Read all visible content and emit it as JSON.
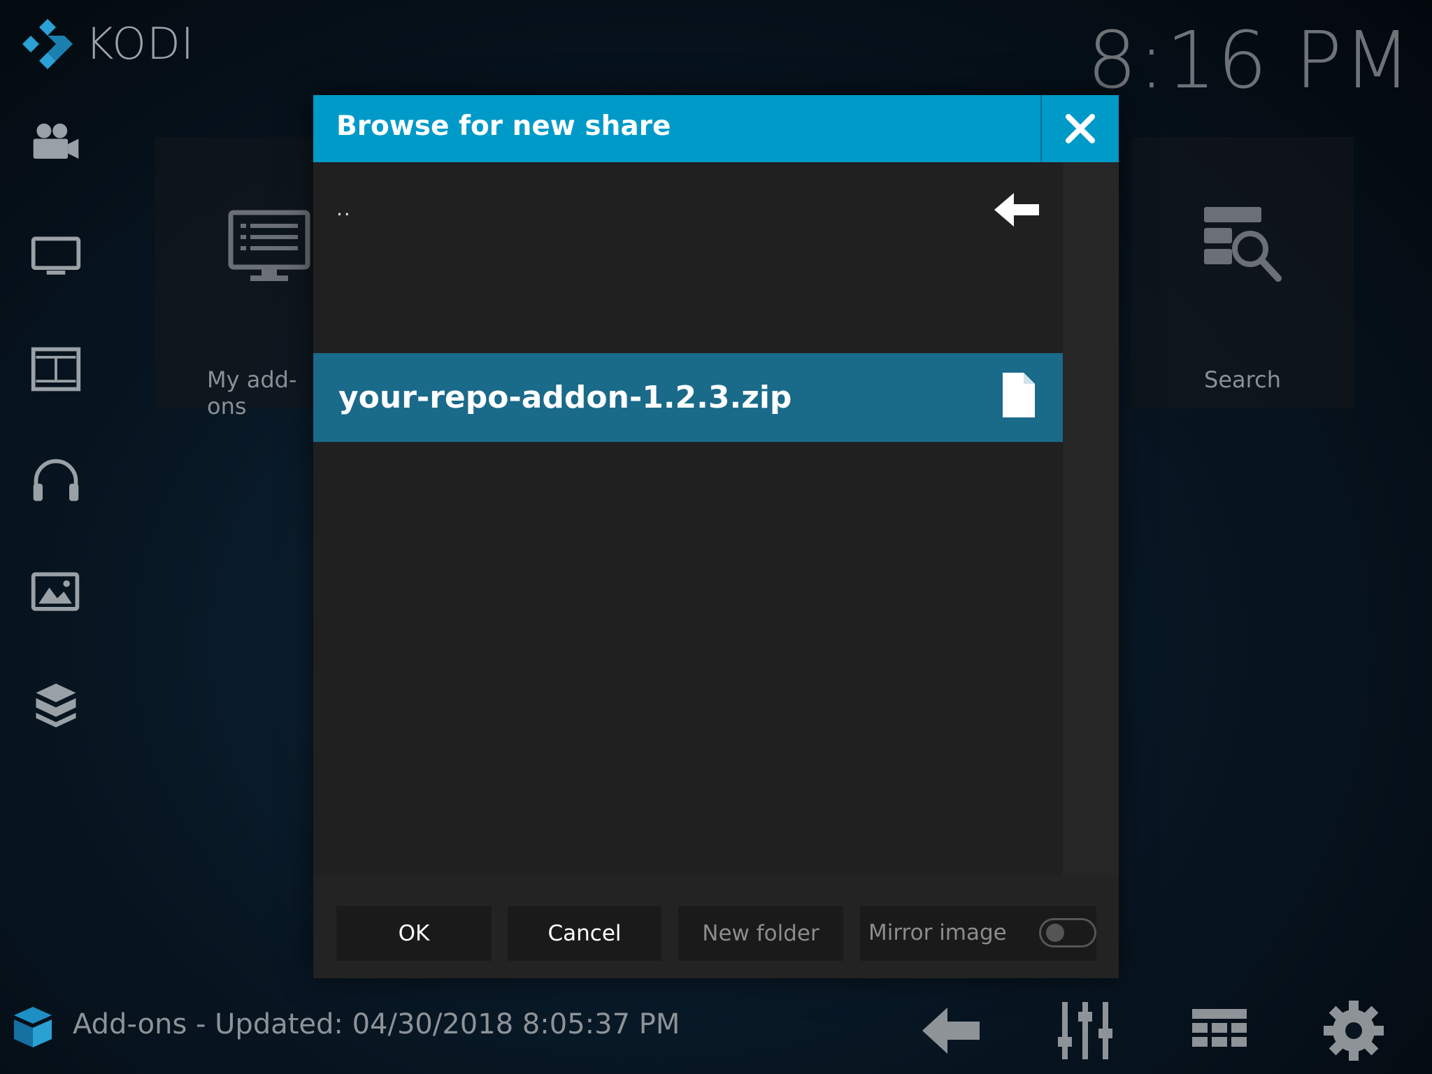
{
  "app": {
    "name": "KODI",
    "clock": "8:16 PM"
  },
  "sidebar": {
    "items": [
      {
        "icon": "movies-icon"
      },
      {
        "icon": "tv-icon"
      },
      {
        "icon": "film-strip-icon"
      },
      {
        "icon": "music-headphones-icon"
      },
      {
        "icon": "pictures-icon"
      },
      {
        "icon": "addons-box-icon"
      }
    ]
  },
  "tiles": {
    "my_addons": "My add-ons",
    "search": "Search"
  },
  "dialog": {
    "title": "Browse for new share",
    "parent_row": "..",
    "files": [
      {
        "name": "your-repo-addon-1.2.3.zip",
        "selected": true
      }
    ],
    "buttons": {
      "ok": "OK",
      "cancel": "Cancel",
      "new_folder": "New folder",
      "mirror": "Mirror image"
    },
    "mirror_enabled": false
  },
  "footer": {
    "status": "Add-ons - Updated: 04/30/2018 8:05:37 PM"
  },
  "colors": {
    "accent": "#009ac8",
    "selected_row": "#1a6a8a"
  }
}
